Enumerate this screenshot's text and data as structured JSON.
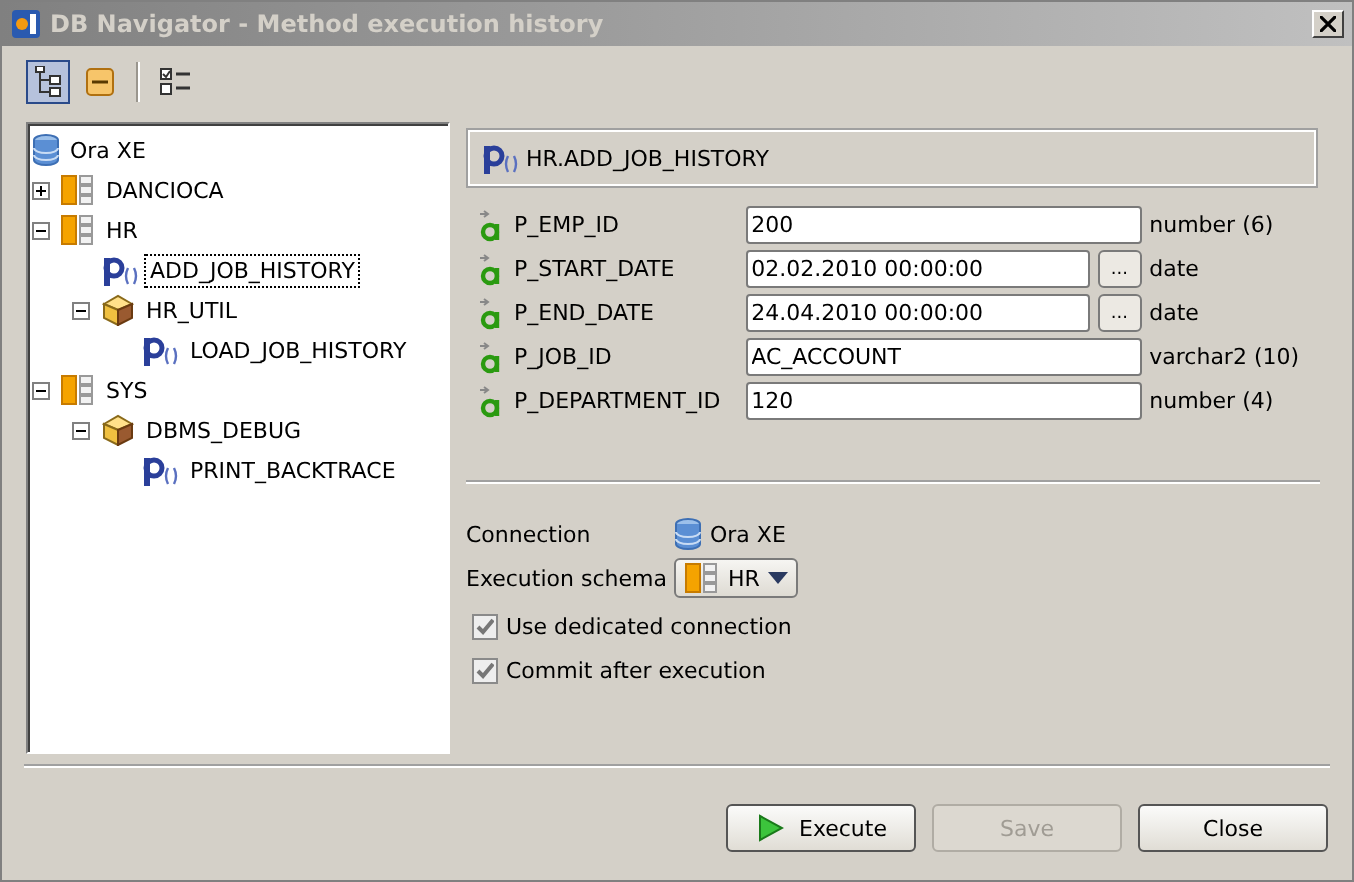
{
  "window": {
    "title": "DB Navigator - Method execution history"
  },
  "toolbar": [
    {
      "kind": "tree",
      "selected": true
    },
    {
      "kind": "collapse",
      "selected": false
    },
    {
      "kind": "checklist",
      "selected": false
    }
  ],
  "tree": [
    {
      "label": "Ora XE",
      "kind": "connection",
      "selected": false,
      "children": [
        {
          "label": "DANCIOCA",
          "kind": "schema",
          "expanded": false,
          "selected": false
        },
        {
          "label": "HR",
          "kind": "schema",
          "expanded": true,
          "selected": false,
          "children": [
            {
              "label": "ADD_JOB_HISTORY",
              "kind": "procedure",
              "selected": true
            },
            {
              "label": "HR_UTIL",
              "kind": "package",
              "expanded": true,
              "selected": false,
              "children": [
                {
                  "label": "LOAD_JOB_HISTORY",
                  "kind": "procedure",
                  "selected": false
                }
              ]
            }
          ]
        },
        {
          "label": "SYS",
          "kind": "schema",
          "expanded": true,
          "selected": false,
          "children": [
            {
              "label": "DBMS_DEBUG",
              "kind": "package",
              "expanded": true,
              "selected": false,
              "children": [
                {
                  "label": "PRINT_BACKTRACE",
                  "kind": "procedure",
                  "selected": false
                }
              ]
            }
          ]
        }
      ]
    }
  ],
  "method": {
    "title": "HR.ADD_JOB_HISTORY"
  },
  "parameters": [
    {
      "name": "P_EMP_ID",
      "value": "200",
      "type": "number (6)"
    },
    {
      "name": "P_START_DATE",
      "value": "02.02.2010 00:00:00",
      "picker": "...",
      "type": "date"
    },
    {
      "name": "P_END_DATE",
      "value": "24.04.2010 00:00:00",
      "picker": "...",
      "type": "date"
    },
    {
      "name": "P_JOB_ID",
      "value": "AC_ACCOUNT",
      "type": "varchar2 (10)"
    },
    {
      "name": "P_DEPARTMENT_ID",
      "value": "120",
      "type": "number (4)"
    }
  ],
  "connection": {
    "label": "Connection",
    "value": "Ora XE"
  },
  "execution_schema": {
    "label": "Execution schema",
    "value": "HR"
  },
  "options": [
    {
      "label": "Use dedicated connection",
      "checked": true
    },
    {
      "label": "Commit after execution",
      "checked": true
    }
  ],
  "buttons": [
    {
      "label": "Execute",
      "kind": "execute",
      "disabled": false
    },
    {
      "label": "Save",
      "kind": "plain",
      "disabled": true
    },
    {
      "label": "Close",
      "kind": "plain",
      "disabled": false
    }
  ]
}
